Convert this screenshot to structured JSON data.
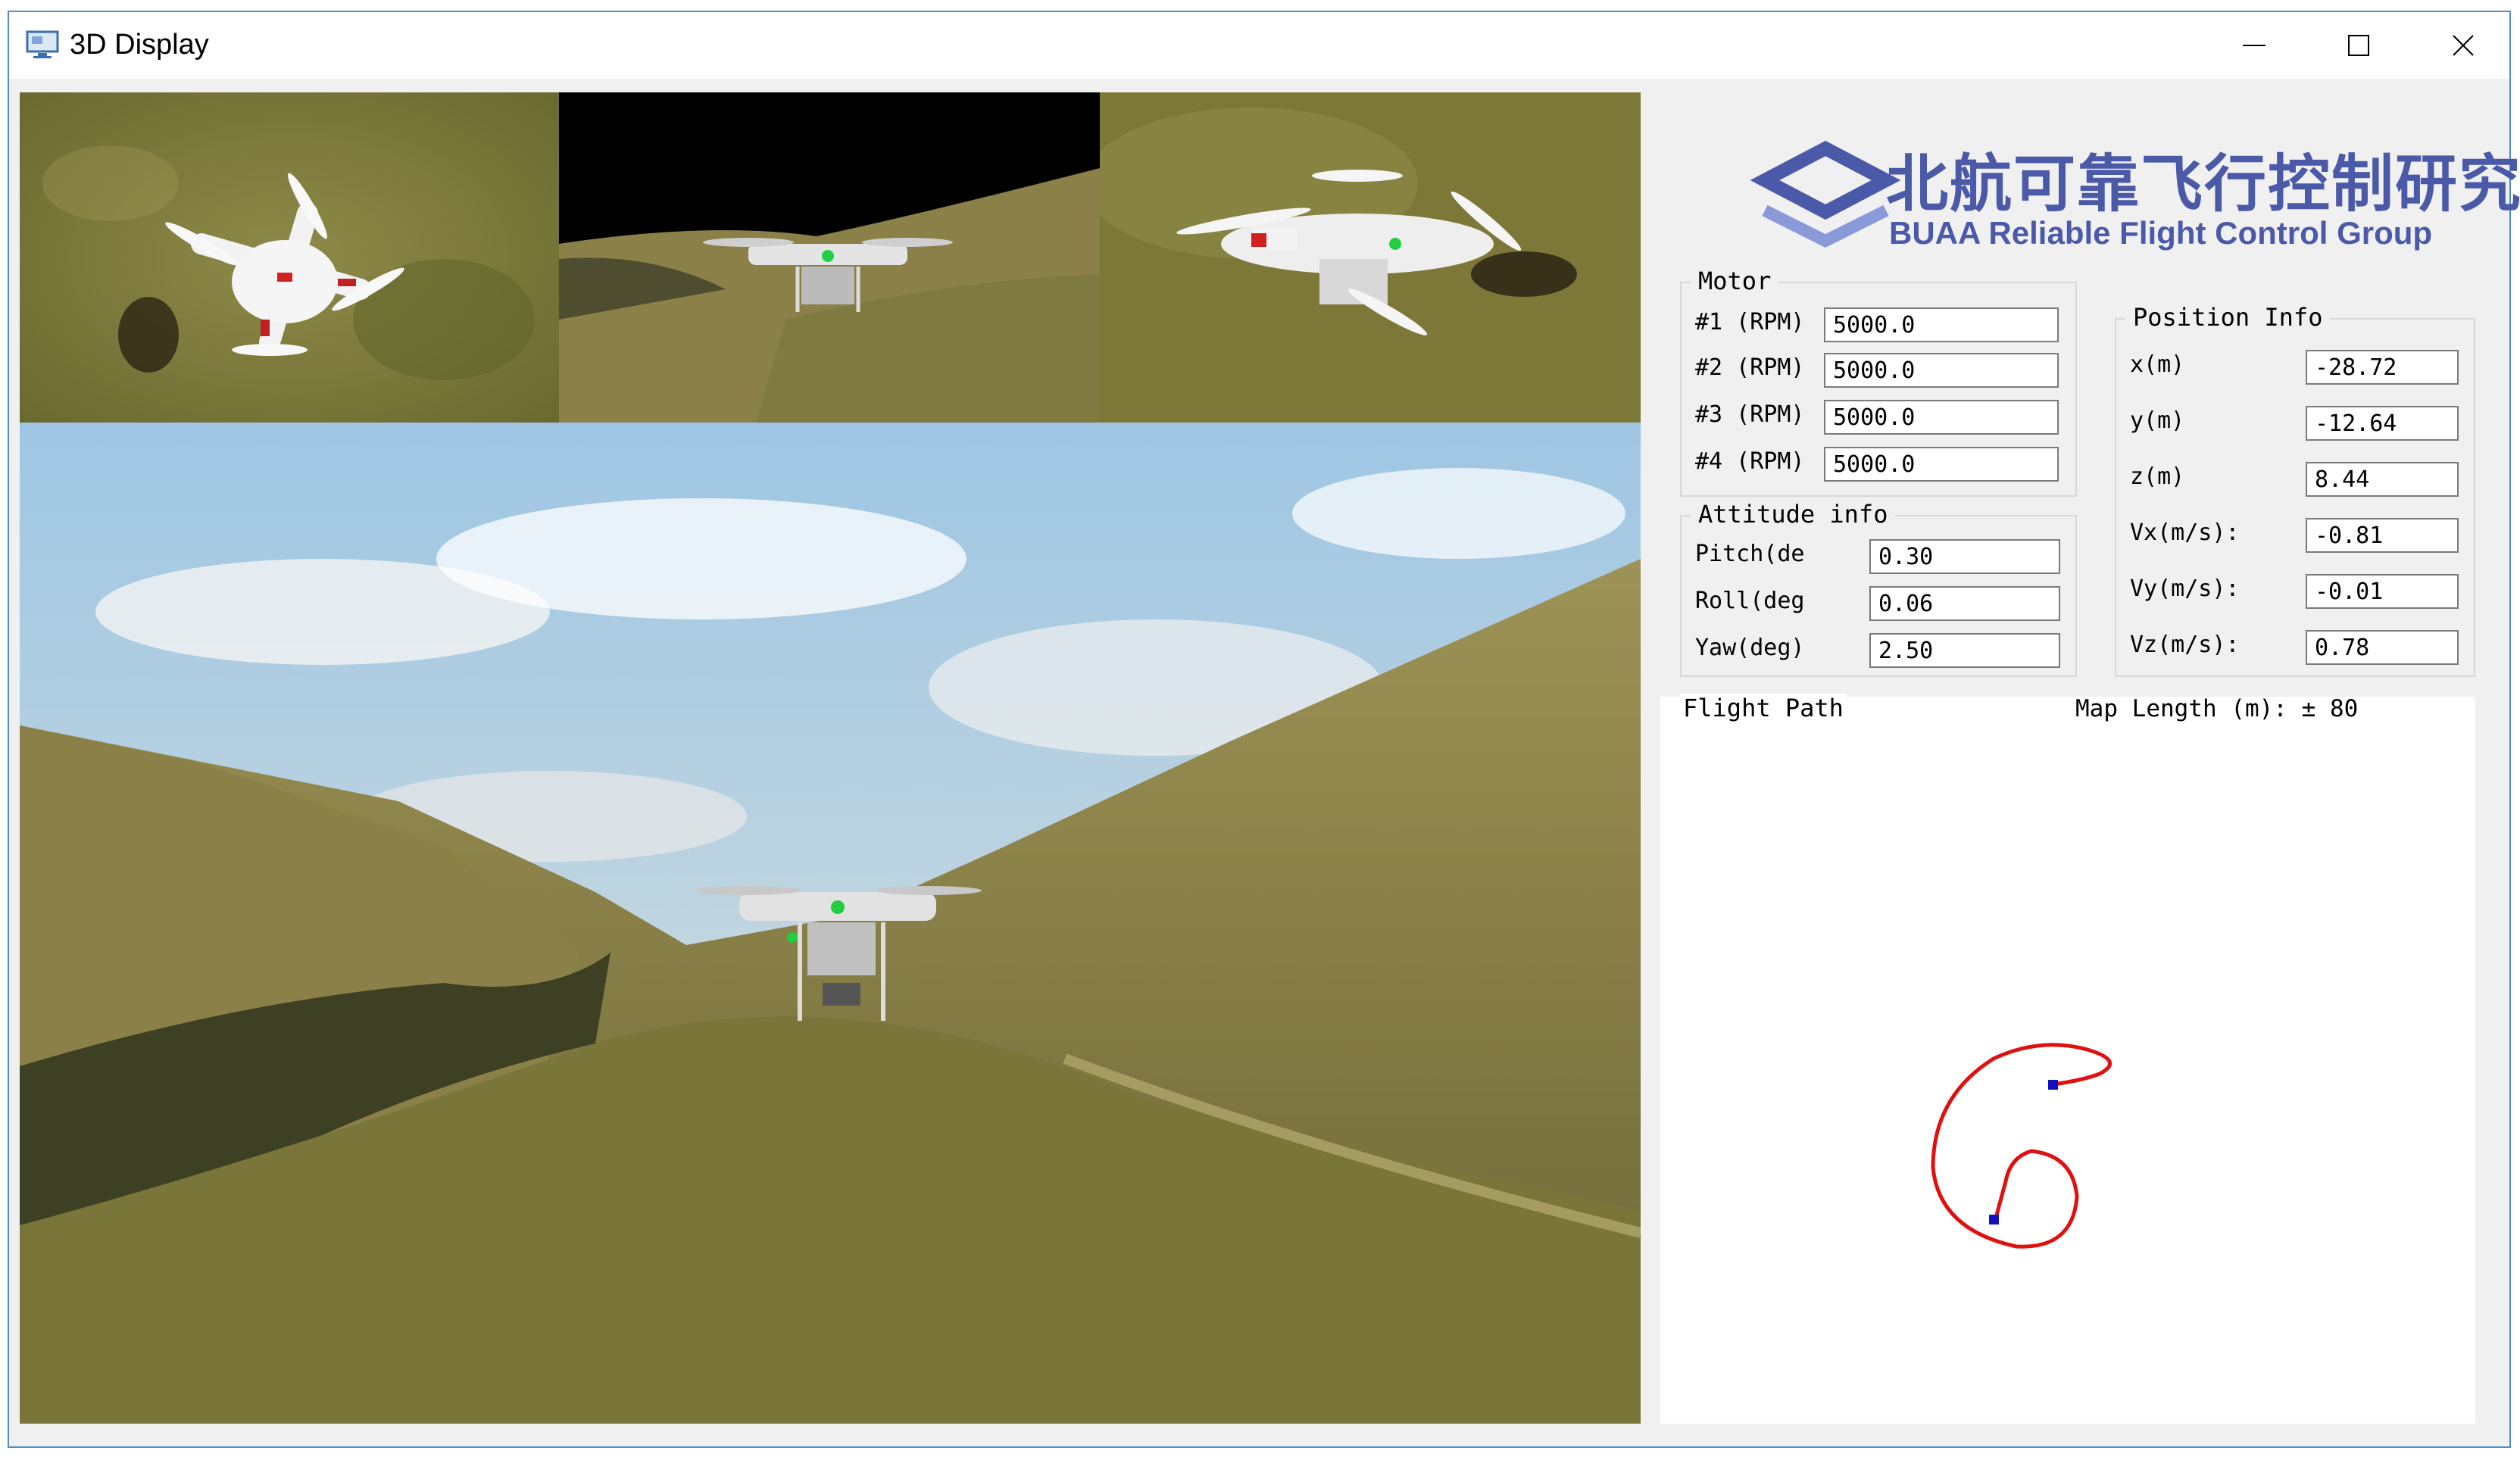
{
  "window": {
    "title": "3D Display"
  },
  "logo": {
    "cn": "北航可靠飞行控制研究组",
    "en": "BUAA Reliable Flight Control Group"
  },
  "motor": {
    "title": "Motor",
    "rows": [
      {
        "label": "#1 (RPM)",
        "value": "5000.0"
      },
      {
        "label": "#2 (RPM)",
        "value": "5000.0"
      },
      {
        "label": "#3 (RPM)",
        "value": "5000.0"
      },
      {
        "label": "#4 (RPM)",
        "value": "5000.0"
      }
    ]
  },
  "attitude": {
    "title": "Attitude info",
    "rows": [
      {
        "label": "Pitch(de",
        "value": "0.30"
      },
      {
        "label": "Roll(deg",
        "value": "0.06"
      },
      {
        "label": "Yaw(deg)",
        "value": "2.50"
      }
    ]
  },
  "position": {
    "title": "Position Info",
    "rows": [
      {
        "label": "x(m)",
        "value": "-28.72"
      },
      {
        "label": "y(m)",
        "value": "-12.64"
      },
      {
        "label": "z(m)",
        "value": "8.44"
      },
      {
        "label": "Vx(m/s):",
        "value": "-0.81"
      },
      {
        "label": "Vy(m/s):",
        "value": "-0.01"
      },
      {
        "label": "Vz(m/s):",
        "value": "0.78"
      }
    ]
  },
  "flight_path": {
    "title": "Flight Path",
    "map_length": "Map Length (m): ± 80"
  },
  "colors": {
    "path": "#e01010",
    "marker": "#1010c0",
    "accent": "#4b5aa8",
    "window_border": "#4f8fc8"
  },
  "icons": {
    "app": "monitor-icon",
    "minimize": "minimize-icon",
    "maximize": "maximize-icon",
    "close": "close-icon"
  }
}
